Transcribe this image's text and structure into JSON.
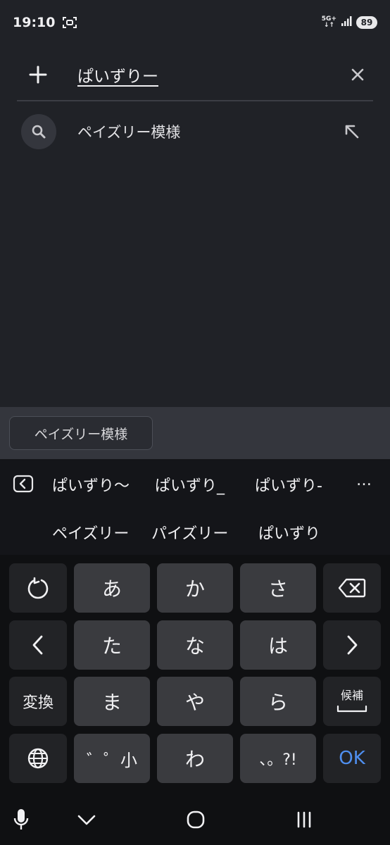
{
  "status": {
    "time": "19:10",
    "network_type_top": "5G+",
    "network_type_bottom": "↓↑",
    "battery": "89"
  },
  "search": {
    "query": "ぱいずりー"
  },
  "suggestions": [
    {
      "text": "ペイズリー模様"
    }
  ],
  "chips": [
    {
      "label": "ペイズリー模様"
    }
  ],
  "keyboard": {
    "candidates_row1": [
      "ぱいずり〜",
      "ぱいずり_",
      "ぱいずり-"
    ],
    "candidates_row2": [
      "ペイズリー",
      "パイズリー",
      "ぱいずり"
    ],
    "more": "…",
    "keys": {
      "a": "あ",
      "ka": "か",
      "sa": "さ",
      "ta": "た",
      "na": "な",
      "ha": "は",
      "henkan": "変換",
      "ma": "ま",
      "ya": "や",
      "ra": "ら",
      "kouho": "候補",
      "modifier": "゛゜小",
      "wa": "わ",
      "punct": "、。?!",
      "ok": "OK"
    },
    "accent": "#4f8ff0"
  }
}
